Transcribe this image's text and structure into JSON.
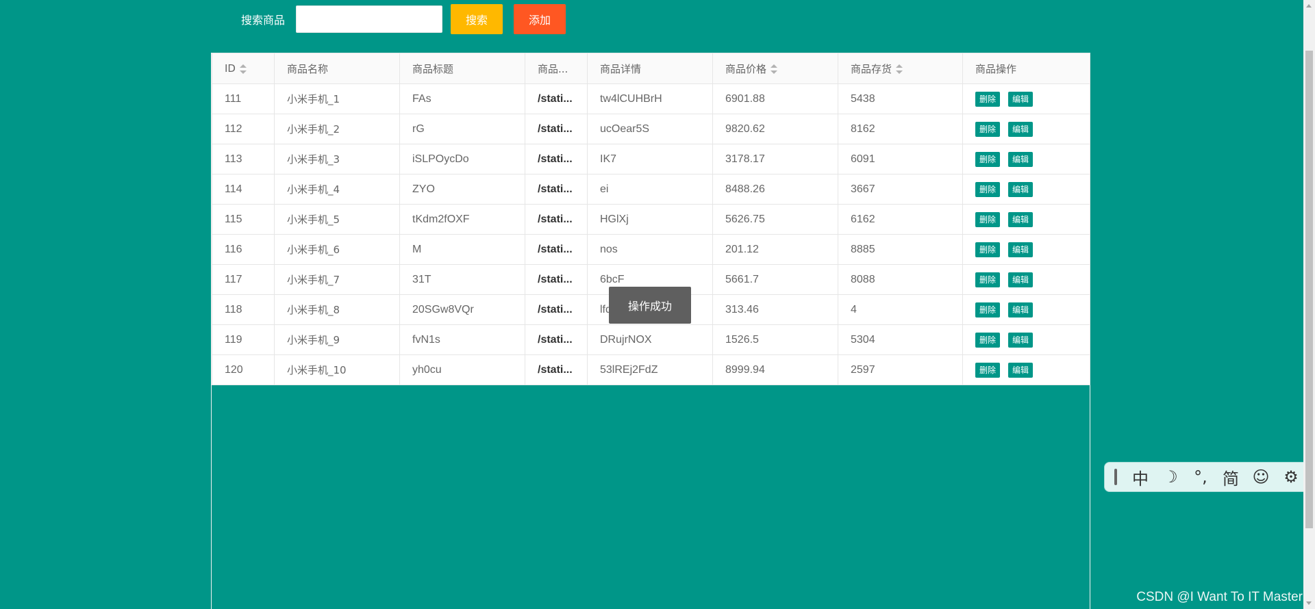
{
  "search": {
    "label": "搜索商品",
    "value": "",
    "placeholder": "",
    "search_button": "搜索",
    "add_button": "添加"
  },
  "table": {
    "headers": [
      "ID",
      "商品名称",
      "商品标题",
      "商品...",
      "商品详情",
      "商品价格",
      "商品存货",
      "商品操作"
    ],
    "rows": [
      {
        "id": "111",
        "name": "小米手机_1",
        "title": "FAs",
        "img": "/stati...",
        "detail": "tw4lCUHBrH",
        "price": "6901.88",
        "stock": "5438"
      },
      {
        "id": "112",
        "name": "小米手机_2",
        "title": "rG",
        "img": "/stati...",
        "detail": "ucOear5S",
        "price": "9820.62",
        "stock": "8162"
      },
      {
        "id": "113",
        "name": "小米手机_3",
        "title": "iSLPOycDo",
        "img": "/stati...",
        "detail": "IK7",
        "price": "3178.17",
        "stock": "6091"
      },
      {
        "id": "114",
        "name": "小米手机_4",
        "title": "ZYO",
        "img": "/stati...",
        "detail": "ei",
        "price": "8488.26",
        "stock": "3667"
      },
      {
        "id": "115",
        "name": "小米手机_5",
        "title": "tKdm2fOXF",
        "img": "/stati...",
        "detail": "HGlXj",
        "price": "5626.75",
        "stock": "6162"
      },
      {
        "id": "116",
        "name": "小米手机_6",
        "title": "M",
        "img": "/stati...",
        "detail": "nos",
        "price": "201.12",
        "stock": "8885"
      },
      {
        "id": "117",
        "name": "小米手机_7",
        "title": "31T",
        "img": "/stati...",
        "detail": "6bcF",
        "price": "5661.7",
        "stock": "8088"
      },
      {
        "id": "118",
        "name": "小米手机_8",
        "title": "20SGw8VQr",
        "img": "/stati...",
        "detail": "lfdHib",
        "price": "313.46",
        "stock": "4"
      },
      {
        "id": "119",
        "name": "小米手机_9",
        "title": "fvN1s",
        "img": "/stati...",
        "detail": "DRujrNOX",
        "price": "1526.5",
        "stock": "5304"
      },
      {
        "id": "120",
        "name": "小米手机_10",
        "title": "yh0cu",
        "img": "/stati...",
        "detail": "53lREj2FdZ",
        "price": "8999.94",
        "stock": "2597"
      }
    ],
    "delete_label": "删除",
    "edit_label": "编辑"
  },
  "toast": {
    "message": "操作成功"
  },
  "ime": {
    "items": [
      "中",
      "☽",
      "°,",
      "简",
      "☺",
      "⚙"
    ]
  },
  "watermark": "CSDN @I Want To IT Master",
  "colors": {
    "background": "#009688",
    "search_button": "#ffb800",
    "add_button": "#ff5722",
    "op_button": "#009688"
  }
}
